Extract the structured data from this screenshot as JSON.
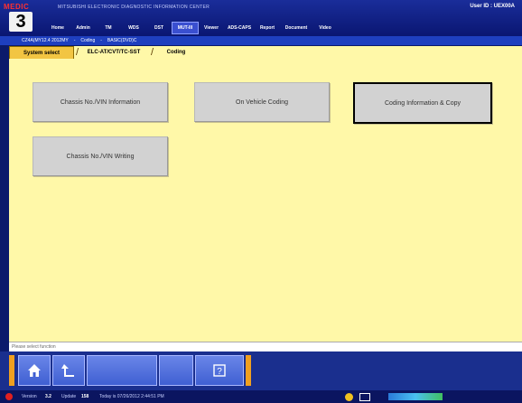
{
  "header": {
    "brand": "MEDIC",
    "brand_number": "3",
    "title": "MITSUBISHI ELECTRONIC DIAGNOSTIC INFORMATION CENTER",
    "user_id": "User ID : UEX00A"
  },
  "nav": {
    "items": [
      {
        "label": "Home",
        "active": false
      },
      {
        "label": "Admin",
        "active": false
      },
      {
        "label": "TM",
        "active": false
      },
      {
        "label": "WDS",
        "active": false
      },
      {
        "label": "DST",
        "active": false
      },
      {
        "label": "MUT-III",
        "active": true
      },
      {
        "label": "Viewer",
        "active": false
      },
      {
        "label": "ADS-CAPS",
        "active": false
      },
      {
        "label": "Report",
        "active": false
      },
      {
        "label": "Document",
        "active": false
      },
      {
        "label": "Video",
        "active": false
      }
    ]
  },
  "breadcrumb": {
    "vehicle": "CZ4A(MY12.4 2012MY",
    "path1": "Coding",
    "path2": "BASIC(DVD)C"
  },
  "tabs": {
    "system_select": "System select",
    "elc": "ELC-AT/CVT/TC-SST",
    "coding": "Coding"
  },
  "functions": {
    "chassis_vin_info": "Chassis No./VIN Information",
    "on_vehicle_coding": "On Vehicle Coding",
    "coding_info_copy": "Coding Information & Copy",
    "chassis_vin_writing": "Chassis No./VIN Writing"
  },
  "status": {
    "message": "Please select function"
  },
  "footer": {
    "version_label": "Version",
    "version_value": "3.2",
    "update_label": "Update",
    "update_value": "158",
    "today": "Today is 07/26/2012 2:44:51 PM"
  },
  "colors": {
    "main_bg": "#fff8a8",
    "header_bg": "#0a1672",
    "tab_active": "#f2c542",
    "accent_orange": "#f0a020"
  }
}
